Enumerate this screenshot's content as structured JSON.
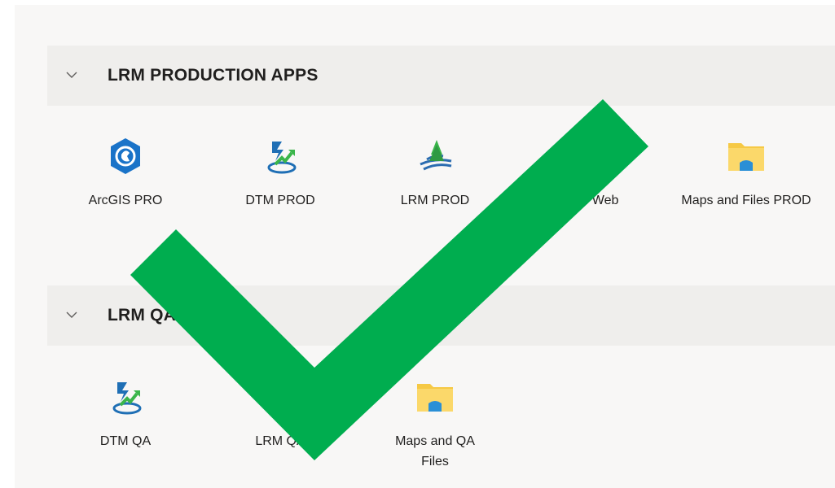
{
  "groups": [
    {
      "title": "LRM PRODUCTION APPS",
      "apps": [
        {
          "label": "ArcGIS PRO",
          "icon": "arcgis-pro-icon"
        },
        {
          "label": "DTM PROD",
          "icon": "dtm-icon"
        },
        {
          "label": "LRM PROD",
          "icon": "lrm-icon"
        },
        {
          "label": "LRM Web",
          "icon": "lrm-web-icon"
        },
        {
          "label": "Maps and Files PROD",
          "icon": "folder-icon"
        }
      ]
    },
    {
      "title": "LRM QA APPS",
      "apps": [
        {
          "label": "DTM QA",
          "icon": "dtm-icon"
        },
        {
          "label": "LRM QA",
          "icon": "lrm-icon"
        },
        {
          "label": "Maps and QA Files",
          "icon": "folder-icon"
        }
      ]
    }
  ],
  "colors": {
    "check": "#00ad4f",
    "arcgis": "#1a73c8",
    "folder": "#f6c945",
    "folder_inner": "#2a8fd6"
  }
}
